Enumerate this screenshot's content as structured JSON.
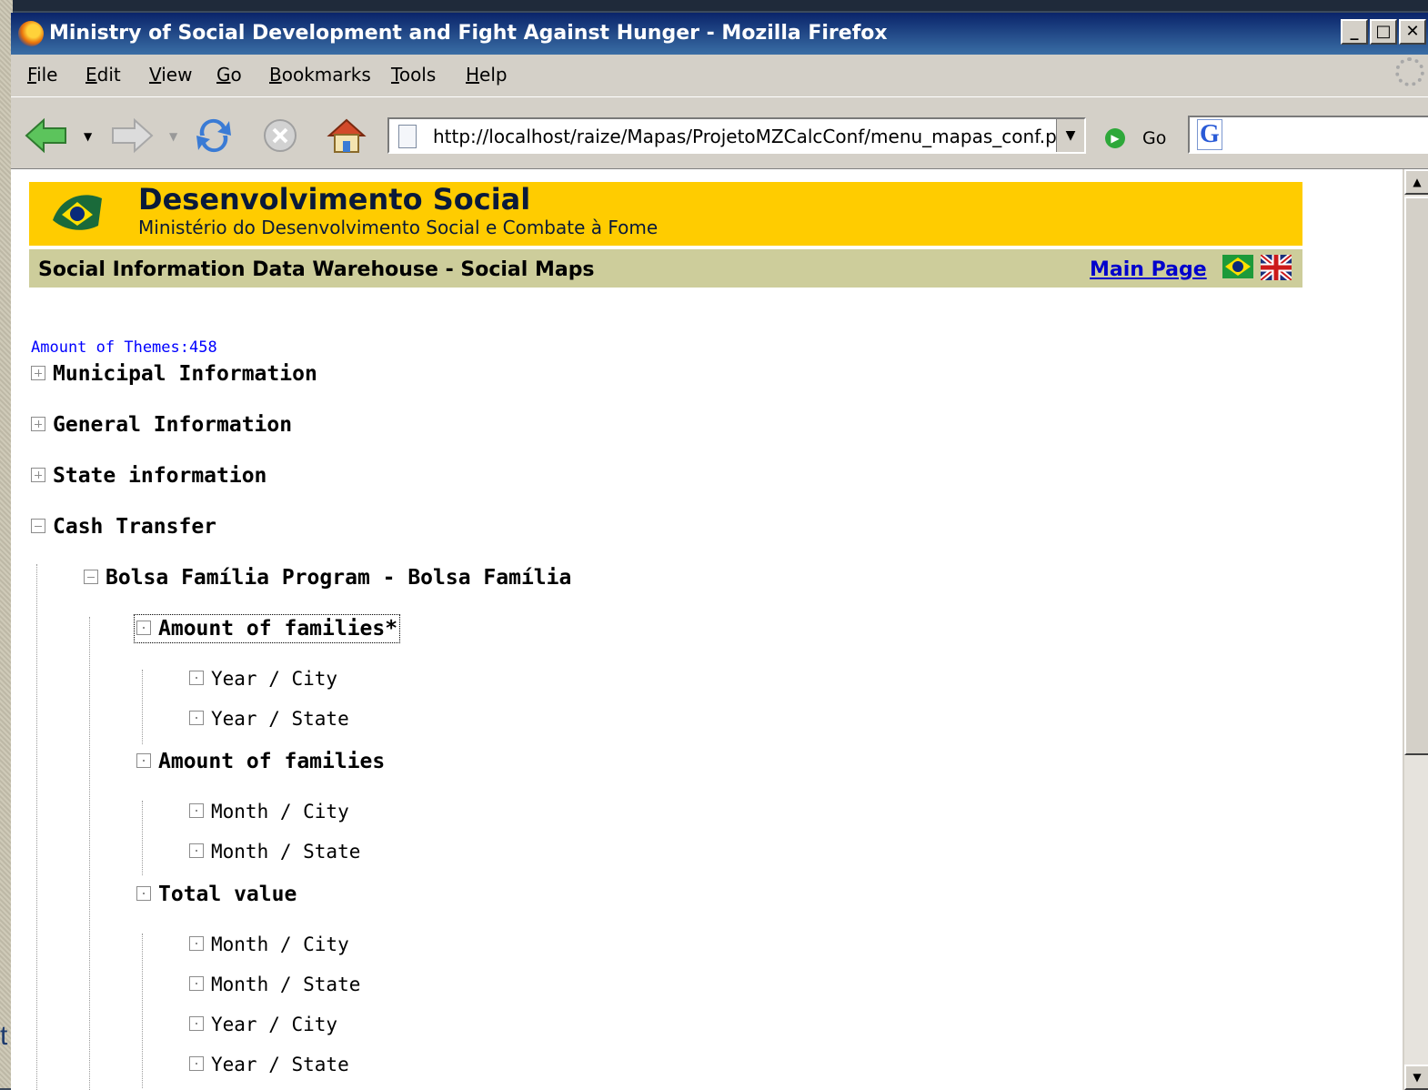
{
  "desktop": {
    "edge_text": "t"
  },
  "window": {
    "title": "Ministry of Social Development and Fight Against Hunger - Mozilla Firefox",
    "controls": {
      "minimize": "_",
      "maximize": "□",
      "close": "✕"
    }
  },
  "menu": {
    "file": "File",
    "edit": "Edit",
    "view": "View",
    "go": "Go",
    "bookmarks": "Bookmarks",
    "tools": "Tools",
    "help": "Help"
  },
  "toolbar": {
    "url": "http://localhost/raize/Mapas/ProjetoMZCalcConf/menu_mapas_conf.p",
    "go_label": "Go",
    "search_engine_glyph": "G"
  },
  "page": {
    "banner": {
      "title": "Desenvolvimento Social",
      "subtitle": "Ministério do Desenvolvimento Social e Combate à Fome"
    },
    "subheader": {
      "title": "Social Information Data Warehouse - Social Maps",
      "main_link": "Main Page"
    },
    "themes_count": "Amount of Themes:458",
    "tree": {
      "municipal": "Municipal Information",
      "general": "General Information",
      "state": "State information",
      "cash": "Cash Transfer",
      "bolsa": "Bolsa Família Program - Bolsa Família",
      "families_star": {
        "label": "Amount of families*",
        "children": [
          "Year / City",
          "Year / State"
        ]
      },
      "families": {
        "label": "Amount of families",
        "children": [
          "Month / City",
          "Month / State"
        ]
      },
      "total": {
        "label": "Total value",
        "children": [
          "Month / City",
          "Month / State",
          "Year / City",
          "Year / State"
        ]
      }
    }
  },
  "colors": {
    "banner_yellow": "#ffcc00",
    "subheader_khaki": "#cdcd9b",
    "link_blue": "#0000cc",
    "count_blue": "#0000ff",
    "titlebar_blue": "#0a246a"
  }
}
